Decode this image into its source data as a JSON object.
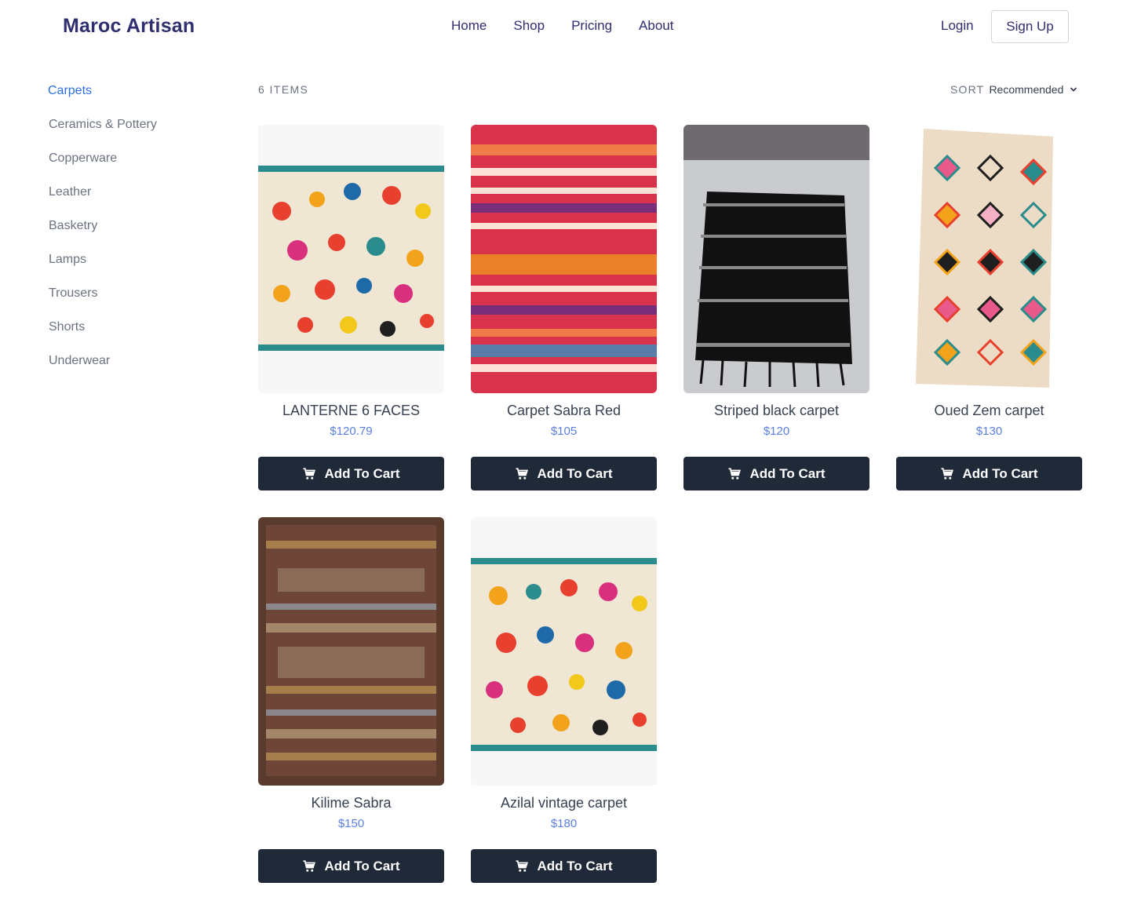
{
  "header": {
    "brand": "Maroc Artisan",
    "nav": [
      "Home",
      "Shop",
      "Pricing",
      "About"
    ],
    "login": "Login",
    "signup": "Sign Up"
  },
  "sidebar": {
    "categories": [
      "Carpets",
      "Ceramics & Pottery",
      "Copperware",
      "Leather",
      "Basketry",
      "Lamps",
      "Trousers",
      "Shorts",
      "Underwear"
    ],
    "active": "Carpets"
  },
  "toolbar": {
    "count": "6 ITEMS",
    "sort_label": "SORT",
    "sort_value": "Recommended"
  },
  "products": [
    {
      "name": "LANTERNE 6 FACES",
      "price": "$120.79",
      "button": "Add To Cart",
      "image": "cream-azilal-rug"
    },
    {
      "name": "Carpet Sabra Red",
      "price": "$105",
      "button": "Add To Cart",
      "image": "red-kilim-rug"
    },
    {
      "name": "Striped black carpet",
      "price": "$120",
      "button": "Add To Cart",
      "image": "black-striped-rug"
    },
    {
      "name": "Oued Zem carpet",
      "price": "$130",
      "button": "Add To Cart",
      "image": "diamond-boucherouite-rug"
    },
    {
      "name": "Kilime Sabra",
      "price": "$150",
      "button": "Add To Cart",
      "image": "brown-kilim-rug"
    },
    {
      "name": "Azilal vintage carpet",
      "price": "$180",
      "button": "Add To Cart",
      "image": "cream-azilal-rug"
    }
  ],
  "colors": {
    "brand": "#2f2e6e",
    "active_category": "#2f6fdc",
    "price": "#5b7fe0",
    "button_bg": "#1f2937"
  }
}
